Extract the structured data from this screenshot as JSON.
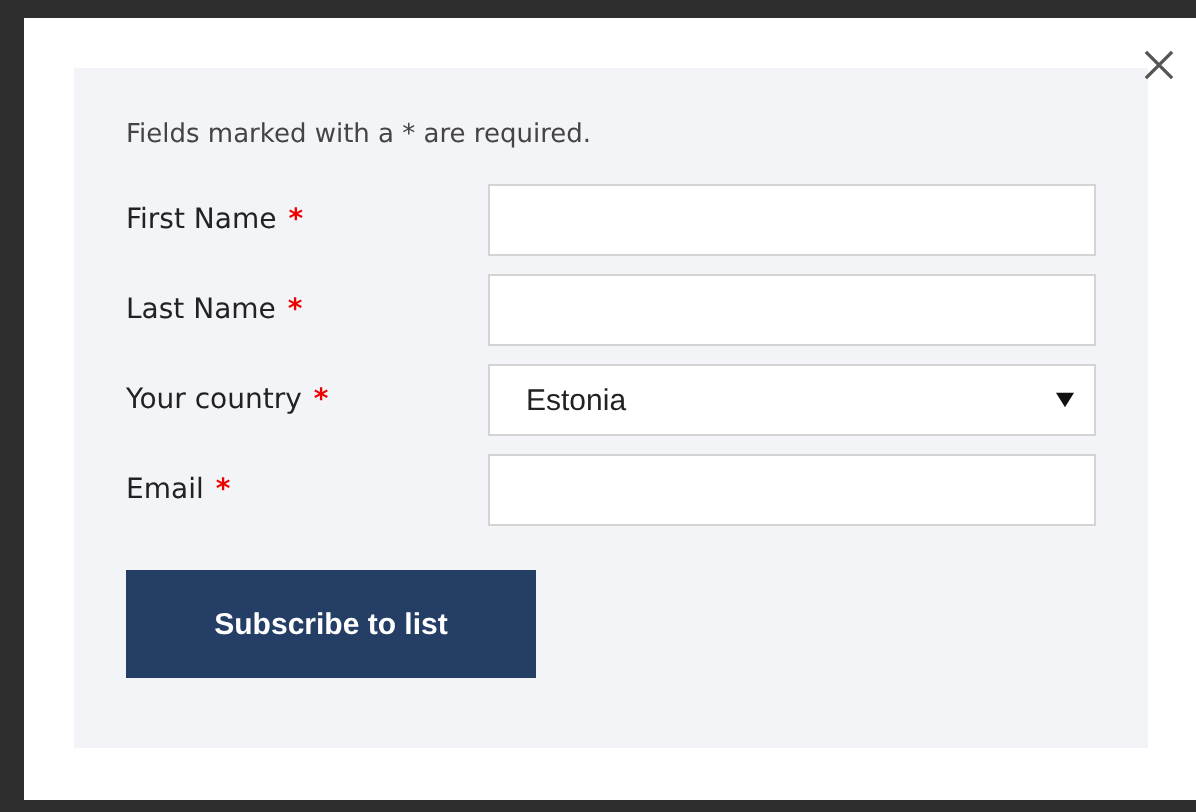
{
  "dialog": {
    "note": "Fields marked with a * are required.",
    "fields": [
      {
        "kind": "text",
        "label": "First Name",
        "required_mark": "*"
      },
      {
        "kind": "text",
        "label": "Last Name",
        "required_mark": "*"
      },
      {
        "kind": "select",
        "label": "Your country",
        "required_mark": "*",
        "value": "Estonia"
      },
      {
        "kind": "text",
        "label": "Email",
        "required_mark": "*"
      }
    ],
    "submit": "Subscribe to list"
  }
}
